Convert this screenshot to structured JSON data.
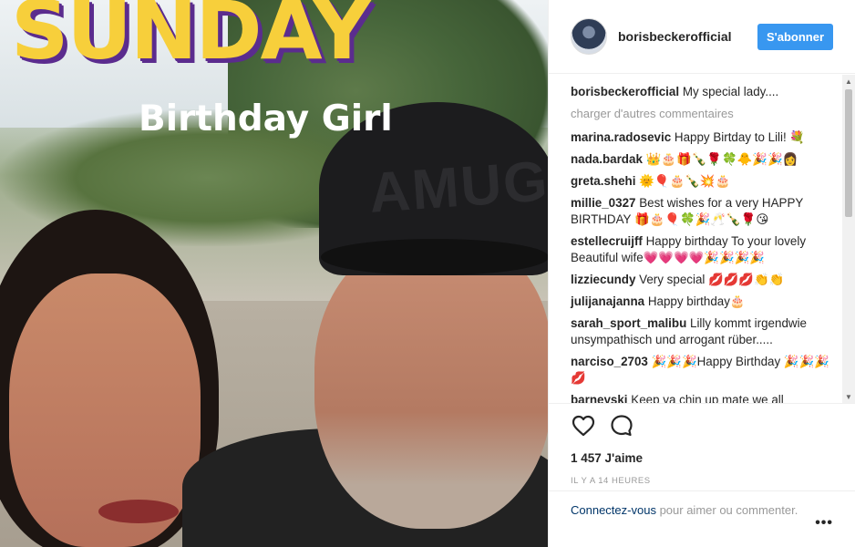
{
  "media": {
    "overlay_title": "SUNDAY",
    "overlay_subtitle": "Birthday Girl",
    "cap_logo": "AMUG"
  },
  "header": {
    "username": "borisbeckerofficial",
    "follow_label": "S'abonner"
  },
  "caption": {
    "username": "borisbeckerofficial",
    "text": "My special lady...."
  },
  "load_more_label": "charger d'autres commentaires",
  "comments": [
    {
      "user": "marina.radosevic",
      "text": "Happy Birtday to Lili! 💐"
    },
    {
      "user": "nada.bardak",
      "text": "👑🎂🎁🍾🌹🍀🐥🎉🎉👩"
    },
    {
      "user": "greta.shehi",
      "text": "🌞🎈🎂🍾💥🎂"
    },
    {
      "user": "millie_0327",
      "text": "Best wishes for a very HAPPY BIRTHDAY 🎁🎂🎈🍀🎉🥂🍾🌹😘"
    },
    {
      "user": "estellecruijff",
      "text": "Happy birthday To your lovely Beautiful wife💗💗💗💗🎉🎉🎉🎉"
    },
    {
      "user": "lizziecundy",
      "text": "Very special 💋💋💋👏👏"
    },
    {
      "user": "julijanajanna",
      "text": "Happy birthday🎂"
    },
    {
      "user": "sarah_sport_malibu",
      "text": "Lilly kommt irgendwie unsympathisch und arrogant rüber....."
    },
    {
      "user": "narciso_2703",
      "text": "🎉🎉🎉Happy Birthday 🎉🎉🎉💋"
    },
    {
      "user": "barneyski",
      "text": "Keep ya chin up mate we all"
    }
  ],
  "icons": {
    "like": "heart-icon",
    "comment": "comment-icon",
    "more": "more-options-icon"
  },
  "likes_text": "1 457 J'aime",
  "timestamp": "IL Y A 14 HEURES",
  "login": {
    "link": "Connectez-vous",
    "text": " pour aimer ou commenter."
  },
  "more_label": "•••",
  "colors": {
    "accent": "#3897f0",
    "link": "#003569",
    "overlay_yellow": "#f7cf3b",
    "overlay_purple": "#5b2c8e"
  }
}
